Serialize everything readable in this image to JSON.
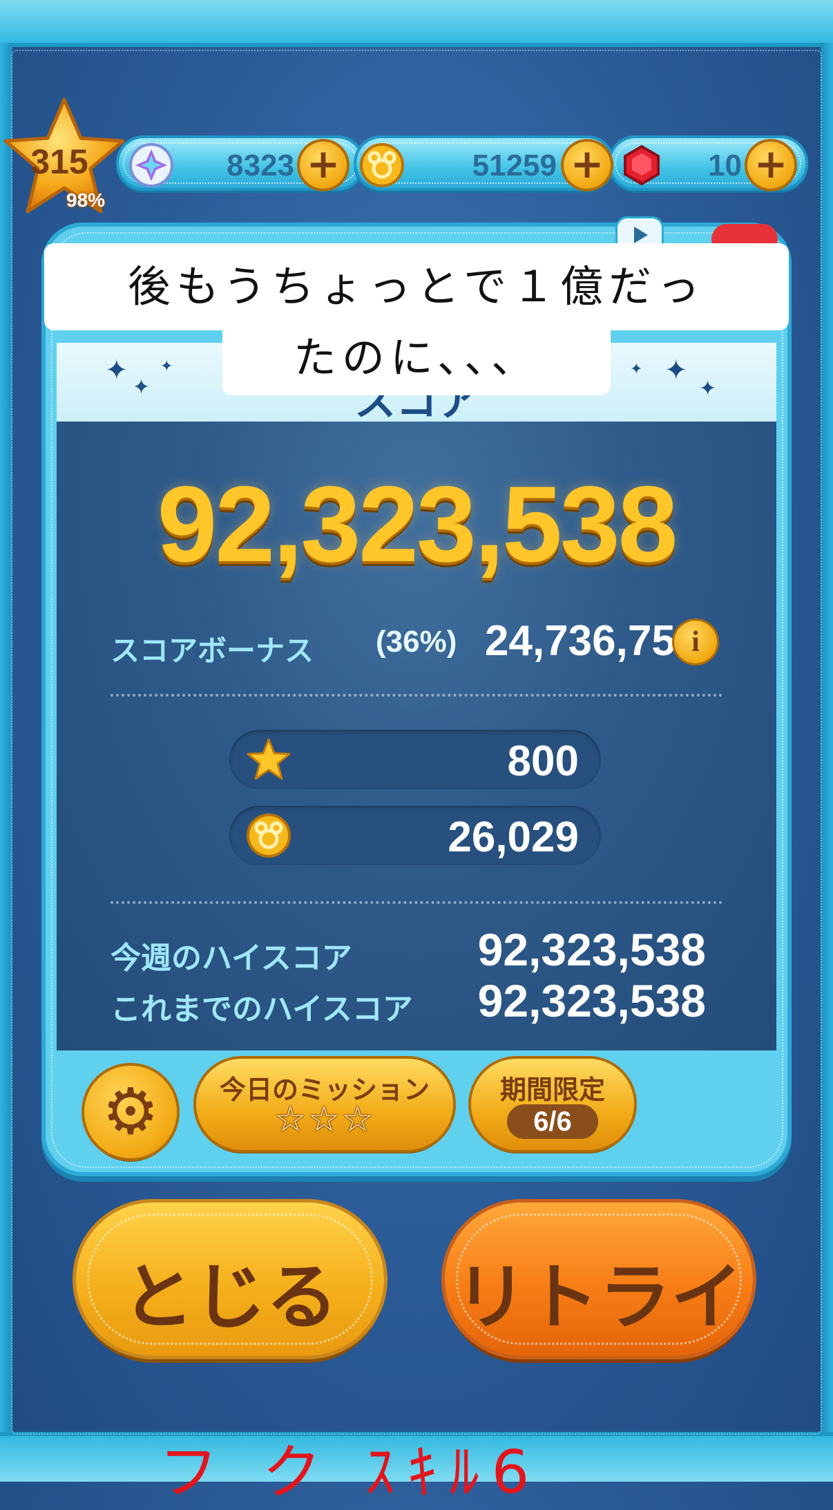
{
  "status_bar": {
    "level": "315",
    "level_progress": "98%",
    "gems_count": "8323",
    "coins_count": "51259",
    "rubies_count": "10",
    "plus_label": "+"
  },
  "caption": {
    "line1": "後もうちょっとで１億だっ",
    "line2": "たのに、、、"
  },
  "panel": {
    "title": "スコア",
    "score": "92,323,538",
    "bonus_label": "スコアボーナス",
    "bonus_percent": "(36%)",
    "bonus_value": "24,736,759",
    "info_label": "i",
    "exp_value": "800",
    "coins_value": "26,029",
    "weekly_highscore_label": "今週のハイスコア",
    "weekly_highscore_value": "92,323,538",
    "alltime_highscore_label": "これまでのハイスコア",
    "alltime_highscore_value": "92,323,538"
  },
  "panel_buttons": {
    "settings_icon": "gear-icon",
    "mission_label": "今日のミッション",
    "mission_stars": "☆☆☆",
    "limited_label": "期間限定",
    "limited_count": "6/6"
  },
  "actions": {
    "close_label": "とじる",
    "retry_label": "リトライ"
  },
  "handwriting": "フ ク ｽｷﾙ6",
  "colors": {
    "accent_cyan": "#41c3e6",
    "gold": "#ffc62a",
    "panel_blue": "#2e5a8a",
    "close_button": "#f5b01c",
    "retry_button": "#f77d16"
  }
}
